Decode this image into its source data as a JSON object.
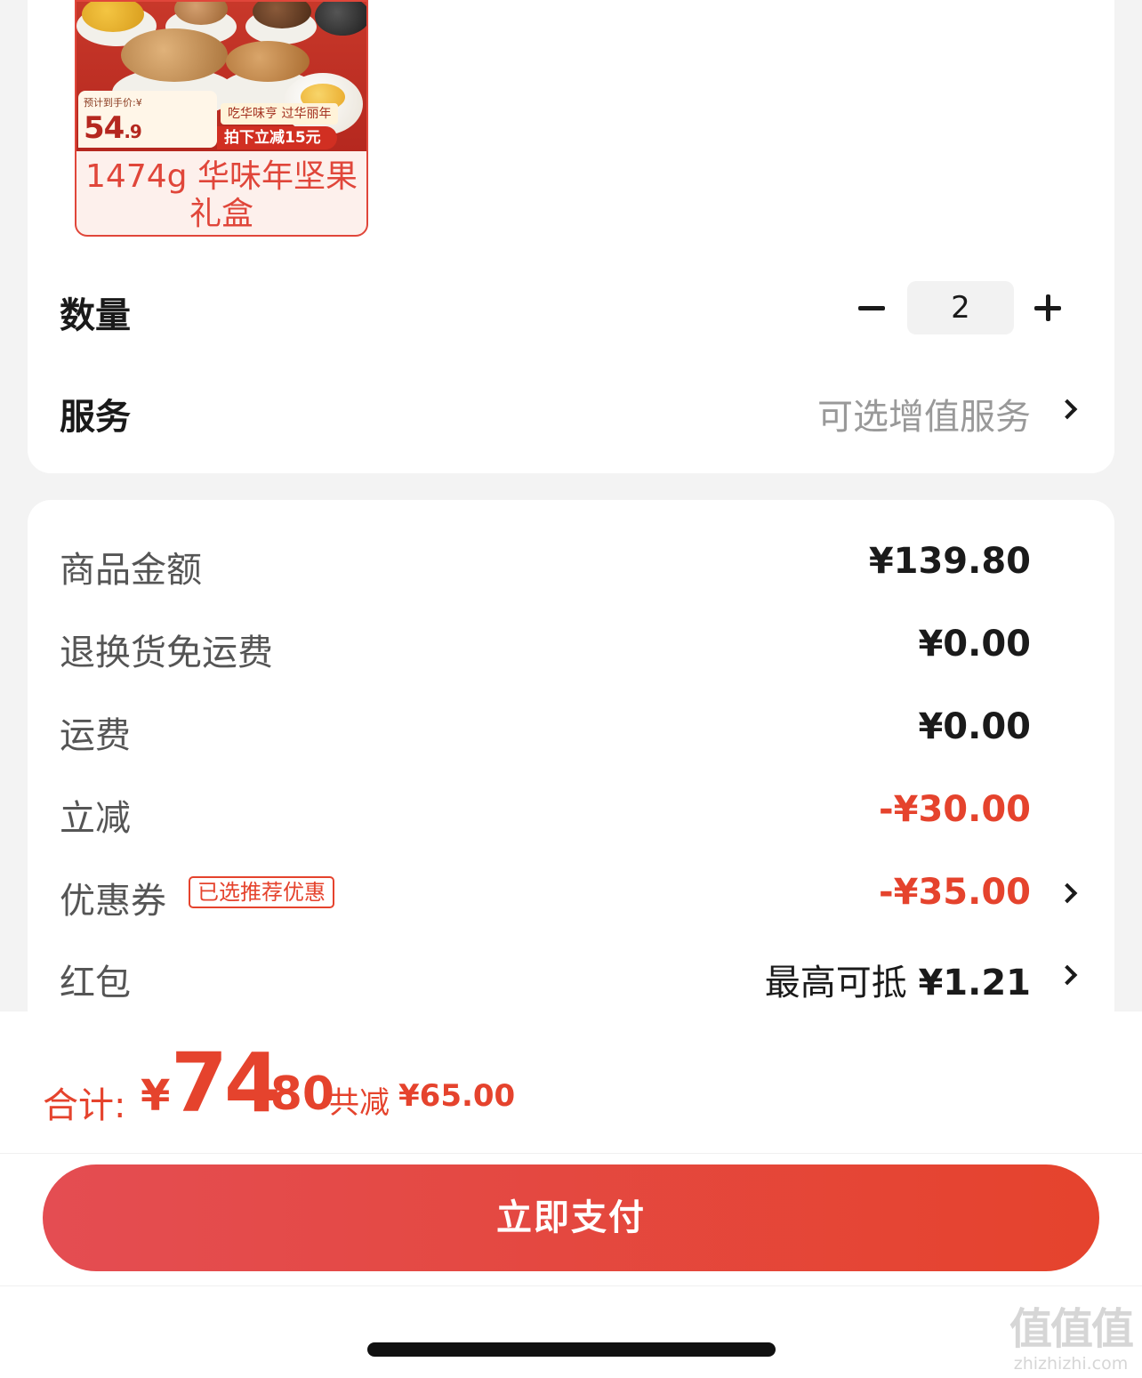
{
  "product": {
    "tag_prefix": "预计到手价:¥",
    "tag_price_int": "54",
    "tag_price_dec": ".9",
    "tag_slogan": "吃华味亨 过华丽年",
    "tag_discount": "拍下立减15元",
    "caption": "1474g 华味年坚果礼盒"
  },
  "quantity": {
    "label": "数量",
    "value": "2"
  },
  "service": {
    "label": "服务",
    "value": "可选增值服务"
  },
  "details": {
    "goods_amount": {
      "label": "商品金额",
      "value": "¥139.80"
    },
    "return_shipping": {
      "label": "退换货免运费",
      "value": "¥0.00"
    },
    "shipping": {
      "label": "运费",
      "value": "¥0.00"
    },
    "instant_discount": {
      "label": "立减",
      "value": "-¥30.00"
    },
    "coupon": {
      "label": "优惠券",
      "badge": "已选推荐优惠",
      "value": "-¥35.00"
    },
    "red_packet": {
      "label": "红包",
      "prefix": "最高可抵",
      "value": "¥1.21"
    }
  },
  "total": {
    "label": "合计:",
    "yen": "¥",
    "int": "74",
    "dec": ".80",
    "saved_label": "共减",
    "saved_value": "¥65.00"
  },
  "pay_button": "立即支付",
  "watermark": {
    "logo": "值值值",
    "text": "zhizhizhi.com"
  },
  "colors": {
    "accent": "#e5432d",
    "button_start": "#e44d52",
    "button_end": "#e5432d"
  }
}
